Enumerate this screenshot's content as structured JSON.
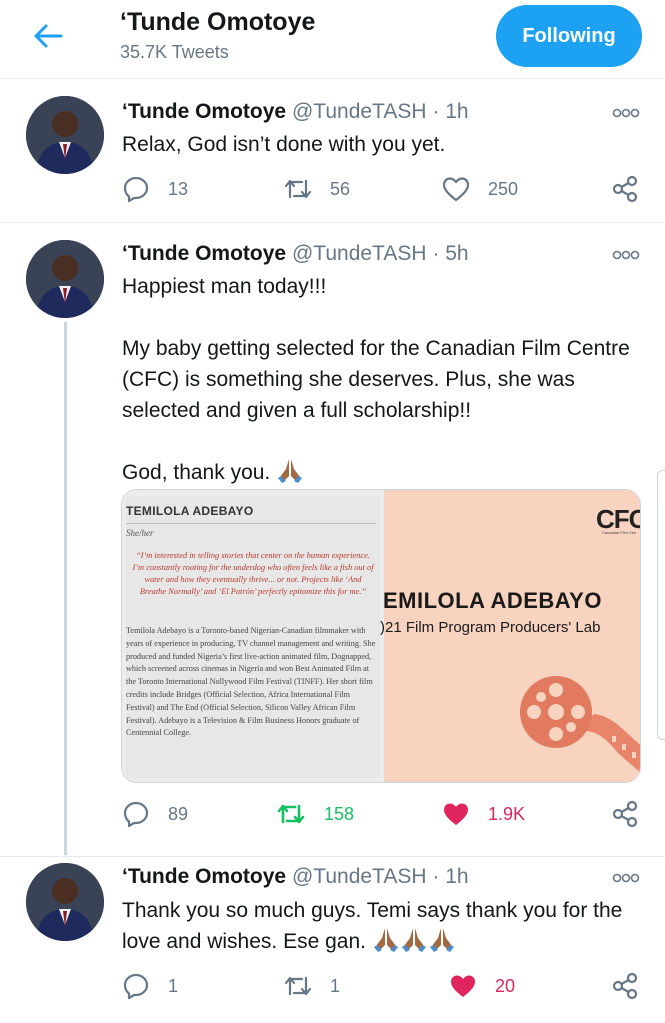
{
  "header": {
    "title": "‘Tunde Omotoye",
    "subtitle": "35.7K Tweets",
    "follow_label": "Following"
  },
  "tweets": [
    {
      "name": "‘Tunde Omotoye",
      "handle": "@TundeTASH",
      "sep": "·",
      "time": "1h",
      "text": [
        "Relax, God isn’t done with you yet."
      ],
      "replies": "13",
      "retweets": "56",
      "likes": "250",
      "liked": false,
      "retweeted": false
    },
    {
      "name": "‘Tunde Omotoye",
      "handle": "@TundeTASH",
      "sep": "·",
      "time": "5h",
      "text": [
        "Happiest man today!!!",
        "My baby getting selected for the Canadian Film Centre (CFC) is something she deserves. Plus, she was selected and given a full scholarship!!",
        "God, thank you."
      ],
      "replies": "89",
      "retweets": "158",
      "likes": "1.9K",
      "liked": true,
      "retweeted": true,
      "media": {
        "left": {
          "name": "TEMILOLA ADEBAYO",
          "pronouns": "She/her",
          "quote": "“I’m interested in telling stories that center on the human experience. I’m constantly rooting for the underdog who often feels like a fish out of water and how they eventually thrive... or not. Projects like ‘And Breathe Normally’ and ‘El Patrón’ perfectly epitomize this for me.”",
          "bio": "Temilola Adebayo is a Toronto-based Nigerian-Canadian filmmaker with years of experience in producing, TV channel management and writing. She produced and funded Nigeria’s first live-action animated film, Dognapped, which screened across cinemas in Nigeria and won Best Animated Film at the Toronto International Nollywood Film Festival (TINFF). Her short film credits include Bridges (Official Selection, Africa International Film Festival) and The End (Official Selection, Silicon Valley African Film Festival). Adebayo is a Television & Film Business Honors graduate of Centennial College."
        },
        "right": {
          "logo": "CFC",
          "logo_sub": "Canadian Film Cen",
          "title": "EMILOLA ADEBAYO",
          "subtitle": ")21 Film Program Producers' Lab"
        }
      }
    },
    {
      "name": "‘Tunde Omotoye",
      "handle": "@TundeTASH",
      "sep": "·",
      "time": "1h",
      "text": [
        "Thank you so much guys. Temi says thank you for the love and wishes. Ese gan."
      ],
      "replies": "1",
      "retweets": "1",
      "likes": "20",
      "liked": true,
      "retweeted": false
    }
  ],
  "colors": {
    "accent": "#1da1f2",
    "like": "#e0245e",
    "retweet": "#17bf63",
    "muted": "#657786"
  },
  "icons": [
    "back-arrow-icon",
    "more-icon",
    "reply-icon",
    "retweet-icon",
    "like-icon",
    "share-icon",
    "folded-hands-emoji",
    "film-reel-icon"
  ]
}
